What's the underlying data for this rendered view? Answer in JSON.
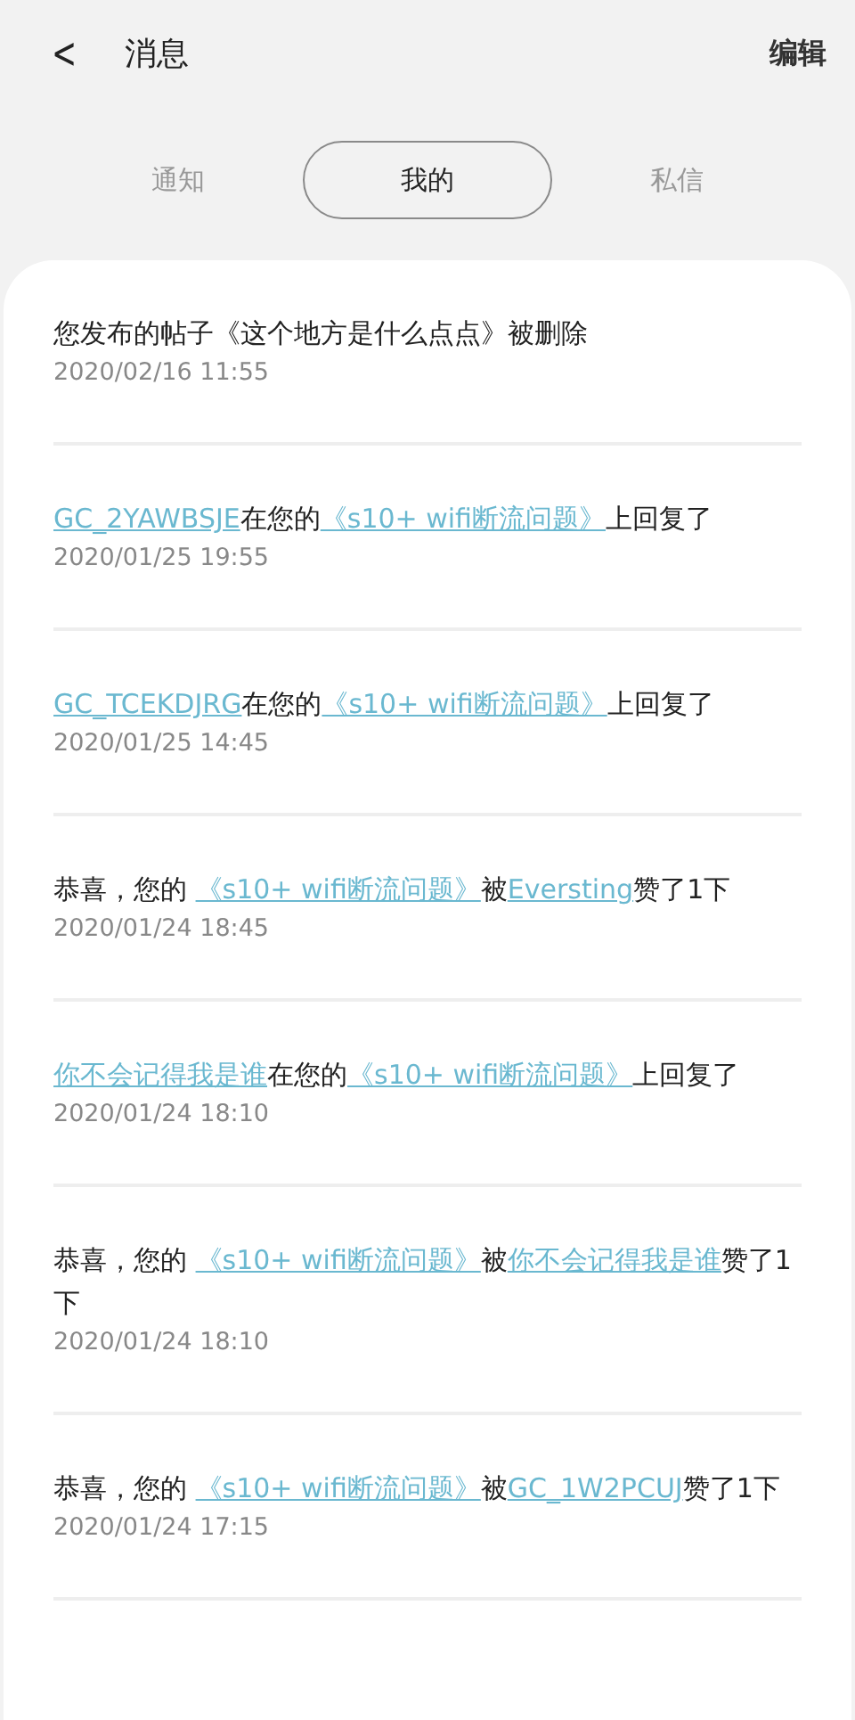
{
  "header": {
    "back": "<",
    "title": "消息",
    "action": "编辑"
  },
  "tabs": [
    {
      "label": "通知",
      "selected": false
    },
    {
      "label": "我的",
      "selected": true
    },
    {
      "label": "私信",
      "selected": false
    }
  ],
  "messages": [
    {
      "parts": [
        {
          "kind": "text",
          "text": "您发布的帖子《这个地方是什么点点》被删除"
        }
      ],
      "time": "2020/02/16 11:55"
    },
    {
      "parts": [
        {
          "kind": "link",
          "text": "GC_2YAWBSJE"
        },
        {
          "kind": "text",
          "text": "在您的"
        },
        {
          "kind": "link",
          "text": "《s10+ wifi断流问题》"
        },
        {
          "kind": "text",
          "text": "上回复了"
        }
      ],
      "time": "2020/01/25 19:55"
    },
    {
      "parts": [
        {
          "kind": "link",
          "text": "GC_TCEKDJRG"
        },
        {
          "kind": "text",
          "text": "在您的"
        },
        {
          "kind": "link",
          "text": "《s10+ wifi断流问题》"
        },
        {
          "kind": "text",
          "text": "上回复了"
        }
      ],
      "time": "2020/01/25 14:45"
    },
    {
      "parts": [
        {
          "kind": "text",
          "text": "恭喜，您的 "
        },
        {
          "kind": "link",
          "text": "《s10+ wifi断流问题》"
        },
        {
          "kind": "text",
          "text": "被"
        },
        {
          "kind": "link",
          "text": "Eversting"
        },
        {
          "kind": "text",
          "text": "赞了1下"
        }
      ],
      "time": "2020/01/24 18:45"
    },
    {
      "parts": [
        {
          "kind": "link",
          "text": "你不会记得我是谁"
        },
        {
          "kind": "text",
          "text": "在您的"
        },
        {
          "kind": "link",
          "text": "《s10+ wifi断流问题》"
        },
        {
          "kind": "text",
          "text": "上回复了"
        }
      ],
      "time": "2020/01/24 18:10"
    },
    {
      "parts": [
        {
          "kind": "text",
          "text": "恭喜，您的 "
        },
        {
          "kind": "link",
          "text": "《s10+ wifi断流问题》"
        },
        {
          "kind": "text",
          "text": "被"
        },
        {
          "kind": "link",
          "text": "你不会记得我是谁"
        },
        {
          "kind": "text",
          "text": "赞了1下"
        }
      ],
      "time": "2020/01/24 18:10"
    },
    {
      "parts": [
        {
          "kind": "text",
          "text": "恭喜，您的 "
        },
        {
          "kind": "link",
          "text": "《s10+ wifi断流问题》"
        },
        {
          "kind": "text",
          "text": "被"
        },
        {
          "kind": "link",
          "text": "GC_1W2PCUJ"
        },
        {
          "kind": "text",
          "text": "赞了1下"
        }
      ],
      "time": "2020/01/24 17:15"
    }
  ]
}
